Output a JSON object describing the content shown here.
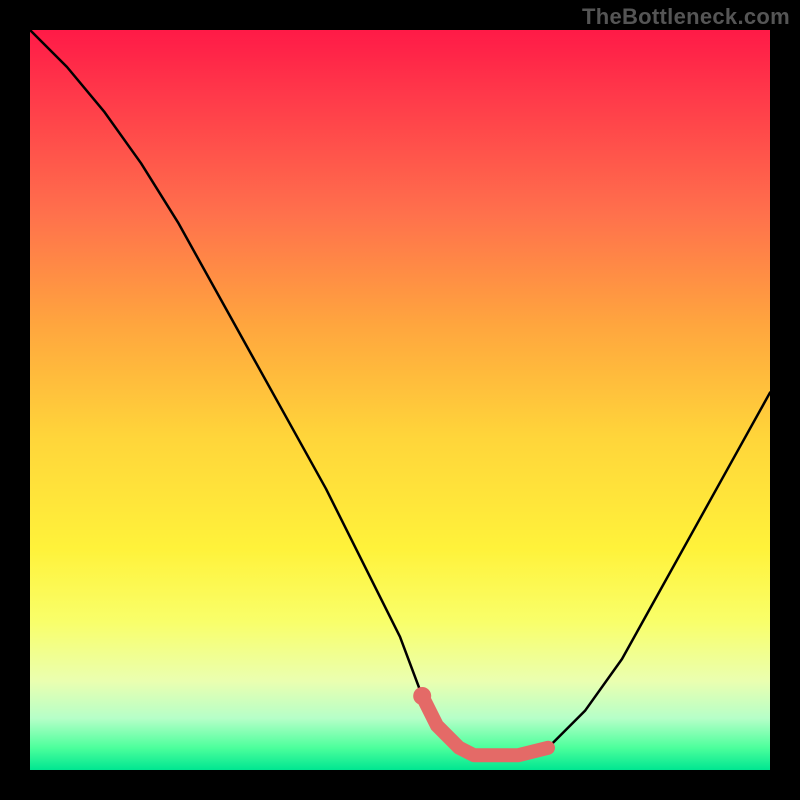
{
  "watermark": "TheBottleneck.com",
  "chart_data": {
    "type": "line",
    "title": "",
    "xlabel": "",
    "ylabel": "",
    "xlim": [
      0,
      100
    ],
    "ylim": [
      0,
      100
    ],
    "grid": false,
    "legend": false,
    "series": [
      {
        "name": "curve",
        "x": [
          0,
          5,
          10,
          15,
          20,
          25,
          30,
          35,
          40,
          45,
          50,
          53,
          55,
          58,
          60,
          63,
          66,
          70,
          75,
          80,
          85,
          90,
          95,
          100
        ],
        "values": [
          100,
          95,
          89,
          82,
          74,
          65,
          56,
          47,
          38,
          28,
          18,
          10,
          6,
          3,
          2,
          2,
          2,
          3,
          8,
          15,
          24,
          33,
          42,
          51
        ]
      },
      {
        "name": "highlight-span",
        "x": [
          53,
          55,
          58,
          60,
          63,
          66,
          70
        ],
        "values": [
          10,
          6,
          3,
          2,
          2,
          2,
          3
        ]
      }
    ],
    "colors": {
      "curve": "#000000",
      "highlight": "#e46a67",
      "highlight_cap": "#e46a67"
    }
  }
}
